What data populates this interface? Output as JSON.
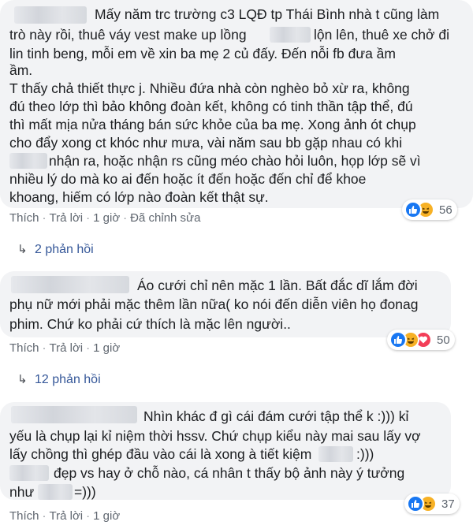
{
  "comments": [
    {
      "lines": [
        "Mấy năm trc trường c3 LQĐ tp Thái Bình nhà t cũng làm",
        "trò này rồi, thuê váy vest make up lồng",
        "lộn lên, thuê xe chở đi",
        "lin tinh beng, mỗi em về xin ba mẹ 2 củ đấy. Đến nỗi fb đưa ầm",
        "ầm.",
        "T thấy chả thiết thực j. Nhiều đứa nhà còn nghèo bỏ xừ ra, không",
        "đú theo lớp thì bảo không đoàn kết, không có tinh thần tập thể, đú",
        "thì mất mịa nửa tháng bán sức khỏe của ba mẹ. Xong ảnh ót chụp",
        "cho đẩy xong ct khóc như mưa, vài năm sau bb gặp nhau có khi",
        "nhận ra, hoặc nhận rs cũng méo chào hỏi luôn, họp lớp sẽ vì",
        "nhiều lý do mà ko ai đến hoặc ít đến hoặc đến chỉ để khoe",
        "khoang, hiếm có lớp nào đoàn kết thật sự."
      ],
      "actions": [
        "Thích",
        "Trả lời",
        "1 giờ",
        "Đã chỉnh sửa"
      ],
      "reaction_count": "56",
      "replies": "2 phản hồi"
    },
    {
      "lines": [
        "Áo cưới chỉ nên mặc 1 lần. Bất đắc dĩ lắm đời",
        "phụ nữ mới phải mặc thêm lần nữa( ko nói đến diễn viên họ đonag",
        "phim. Chứ ko phải cứ thích là mặc lên người.."
      ],
      "actions": [
        "Thích",
        "Trả lời",
        "1 giờ"
      ],
      "reaction_count": "50",
      "replies": "12 phản hồi"
    },
    {
      "lines": [
        "Nhìn khác đ gì cái đám cưới tập thể k :))) kỉ",
        "yếu là chụp lại kỉ niệm thời hssv. Chứ chụp kiểu này mai sau lấy vợ",
        "lấy chồng thì ghép đầu vào cái là xong à tiết kiệm",
        ":)))",
        "đẹp vs hay ở chỗ nào, cá nhân t thấy bộ ảnh này ý tưởng",
        "như",
        "=)))"
      ],
      "actions": [
        "Thích",
        "Trả lời",
        "1 giờ"
      ],
      "reaction_count": "37"
    }
  ],
  "colors": {
    "bubble": "#f2f3f5",
    "link": "#365899",
    "meta": "#606770",
    "like": "#1877f2",
    "haha": "#f7b125",
    "love": "#f33e58"
  }
}
